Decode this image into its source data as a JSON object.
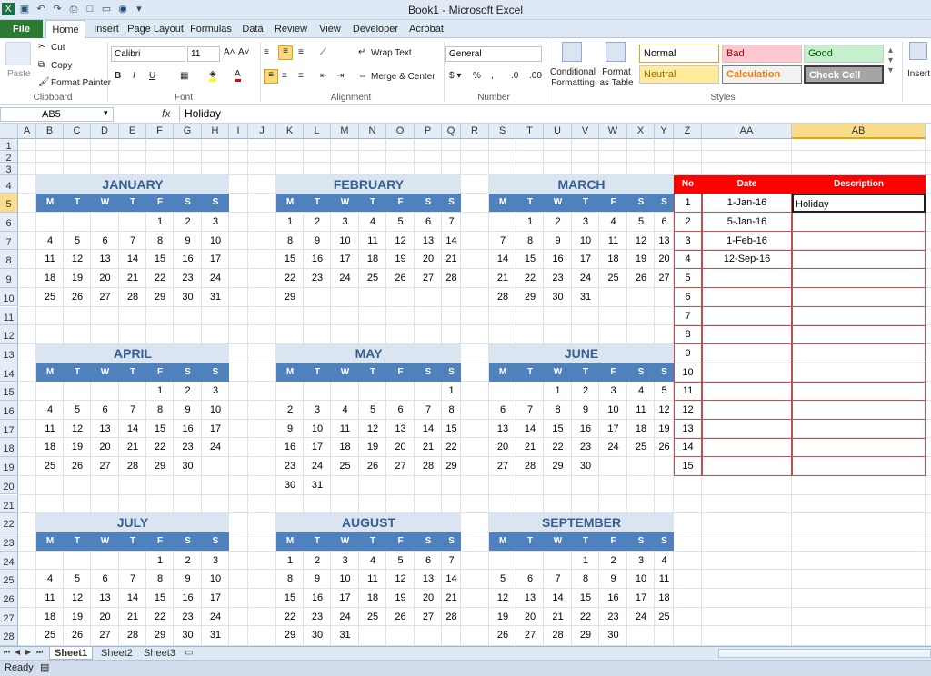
{
  "window": {
    "title": "Book1  -  Microsoft Excel"
  },
  "tabs": [
    "File",
    "Home",
    "Insert",
    "Page Layout",
    "Formulas",
    "Data",
    "Review",
    "View",
    "Developer",
    "Acrobat"
  ],
  "ribbon": {
    "clipboard": {
      "paste": "Paste",
      "cut": "Cut",
      "copy": "Copy",
      "format_painter": "Format Painter",
      "label": "Clipboard"
    },
    "font": {
      "name": "Calibri",
      "size": "11",
      "label": "Font"
    },
    "alignment": {
      "wrap": "Wrap Text",
      "merge": "Merge & Center",
      "label": "Alignment"
    },
    "number": {
      "format": "General",
      "label": "Number"
    },
    "styles": {
      "conditional": "Conditional Formatting",
      "format_table": "Format as Table",
      "normal": "Normal",
      "bad": "Bad",
      "good": "Good",
      "neutral": "Neutral",
      "calculation": "Calculation",
      "check_cell": "Check Cell",
      "label": "Styles"
    },
    "cells": {
      "insert": "Insert"
    }
  },
  "formula_bar": {
    "name_box": "AB5",
    "fx": "fx",
    "value": "Holiday"
  },
  "columns": [
    "A",
    "B",
    "C",
    "D",
    "E",
    "F",
    "G",
    "H",
    "I",
    "J",
    "K",
    "L",
    "M",
    "N",
    "O",
    "P",
    "Q",
    "R",
    "S",
    "T",
    "U",
    "V",
    "W",
    "X",
    "Y",
    "Z",
    "AA",
    "AB"
  ],
  "rows": [
    "1",
    "2",
    "3",
    "4",
    "5",
    "6",
    "7",
    "8",
    "9",
    "10",
    "11",
    "12",
    "13",
    "14",
    "15",
    "16",
    "17",
    "18",
    "19",
    "20",
    "21",
    "22",
    "23",
    "24",
    "25",
    "26",
    "27",
    "28"
  ],
  "weekdays": [
    "M",
    "T",
    "W",
    "T",
    "F",
    "S",
    "S"
  ],
  "months": [
    {
      "name": "JANUARY",
      "weeks": [
        [
          "",
          "",
          "",
          "",
          "1",
          "2",
          "3"
        ],
        [
          "4",
          "5",
          "6",
          "7",
          "8",
          "9",
          "10"
        ],
        [
          "11",
          "12",
          "13",
          "14",
          "15",
          "16",
          "17"
        ],
        [
          "18",
          "19",
          "20",
          "21",
          "22",
          "23",
          "24"
        ],
        [
          "25",
          "26",
          "27",
          "28",
          "29",
          "30",
          "31"
        ]
      ]
    },
    {
      "name": "FEBRUARY",
      "weeks": [
        [
          "1",
          "2",
          "3",
          "4",
          "5",
          "6",
          "7"
        ],
        [
          "8",
          "9",
          "10",
          "11",
          "12",
          "13",
          "14"
        ],
        [
          "15",
          "16",
          "17",
          "18",
          "19",
          "20",
          "21"
        ],
        [
          "22",
          "23",
          "24",
          "25",
          "26",
          "27",
          "28"
        ],
        [
          "29",
          "",
          "",
          "",
          "",
          "",
          ""
        ]
      ]
    },
    {
      "name": "MARCH",
      "weeks": [
        [
          "",
          "1",
          "2",
          "3",
          "4",
          "5",
          "6"
        ],
        [
          "7",
          "8",
          "9",
          "10",
          "11",
          "12",
          "13"
        ],
        [
          "14",
          "15",
          "16",
          "17",
          "18",
          "19",
          "20"
        ],
        [
          "21",
          "22",
          "23",
          "24",
          "25",
          "26",
          "27"
        ],
        [
          "28",
          "29",
          "30",
          "31",
          "",
          "",
          ""
        ]
      ]
    },
    {
      "name": "APRIL",
      "weeks": [
        [
          "",
          "",
          "",
          "",
          "1",
          "2",
          "3"
        ],
        [
          "4",
          "5",
          "6",
          "7",
          "8",
          "9",
          "10"
        ],
        [
          "11",
          "12",
          "13",
          "14",
          "15",
          "16",
          "17"
        ],
        [
          "18",
          "19",
          "20",
          "21",
          "22",
          "23",
          "24"
        ],
        [
          "25",
          "26",
          "27",
          "28",
          "29",
          "30",
          ""
        ]
      ]
    },
    {
      "name": "MAY",
      "weeks": [
        [
          "",
          "",
          "",
          "",
          "",
          "",
          "1"
        ],
        [
          "2",
          "3",
          "4",
          "5",
          "6",
          "7",
          "8"
        ],
        [
          "9",
          "10",
          "11",
          "12",
          "13",
          "14",
          "15"
        ],
        [
          "16",
          "17",
          "18",
          "19",
          "20",
          "21",
          "22"
        ],
        [
          "23",
          "24",
          "25",
          "26",
          "27",
          "28",
          "29"
        ],
        [
          "30",
          "31",
          "",
          "",
          "",
          "",
          ""
        ]
      ]
    },
    {
      "name": "JUNE",
      "weeks": [
        [
          "",
          "",
          "1",
          "2",
          "3",
          "4",
          "5"
        ],
        [
          "6",
          "7",
          "8",
          "9",
          "10",
          "11",
          "12"
        ],
        [
          "13",
          "14",
          "15",
          "16",
          "17",
          "18",
          "19"
        ],
        [
          "20",
          "21",
          "22",
          "23",
          "24",
          "25",
          "26"
        ],
        [
          "27",
          "28",
          "29",
          "30",
          "",
          "",
          ""
        ]
      ]
    },
    {
      "name": "JULY",
      "weeks": [
        [
          "",
          "",
          "",
          "",
          "1",
          "2",
          "3"
        ],
        [
          "4",
          "5",
          "6",
          "7",
          "8",
          "9",
          "10"
        ],
        [
          "11",
          "12",
          "13",
          "14",
          "15",
          "16",
          "17"
        ],
        [
          "18",
          "19",
          "20",
          "21",
          "22",
          "23",
          "24"
        ],
        [
          "25",
          "26",
          "27",
          "28",
          "29",
          "30",
          "31"
        ]
      ]
    },
    {
      "name": "AUGUST",
      "weeks": [
        [
          "1",
          "2",
          "3",
          "4",
          "5",
          "6",
          "7"
        ],
        [
          "8",
          "9",
          "10",
          "11",
          "12",
          "13",
          "14"
        ],
        [
          "15",
          "16",
          "17",
          "18",
          "19",
          "20",
          "21"
        ],
        [
          "22",
          "23",
          "24",
          "25",
          "26",
          "27",
          "28"
        ],
        [
          "29",
          "30",
          "31",
          "",
          "",
          "",
          ""
        ]
      ]
    },
    {
      "name": "SEPTEMBER",
      "weeks": [
        [
          "",
          "",
          "",
          "1",
          "2",
          "3",
          "4"
        ],
        [
          "5",
          "6",
          "7",
          "8",
          "9",
          "10",
          "11"
        ],
        [
          "12",
          "13",
          "14",
          "15",
          "16",
          "17",
          "18"
        ],
        [
          "19",
          "20",
          "21",
          "22",
          "23",
          "24",
          "25"
        ],
        [
          "26",
          "27",
          "28",
          "29",
          "30",
          "",
          ""
        ]
      ]
    }
  ],
  "holiday_table": {
    "headers": [
      "No",
      "Date",
      "Description"
    ],
    "rows": [
      [
        "1",
        "1-Jan-16",
        "Holiday"
      ],
      [
        "2",
        "5-Jan-16",
        ""
      ],
      [
        "3",
        "1-Feb-16",
        ""
      ],
      [
        "4",
        "12-Sep-16",
        ""
      ],
      [
        "5",
        "",
        ""
      ],
      [
        "6",
        "",
        ""
      ],
      [
        "7",
        "",
        ""
      ],
      [
        "8",
        "",
        ""
      ],
      [
        "9",
        "",
        ""
      ],
      [
        "10",
        "",
        ""
      ],
      [
        "11",
        "",
        ""
      ],
      [
        "12",
        "",
        ""
      ],
      [
        "13",
        "",
        ""
      ],
      [
        "14",
        "",
        ""
      ],
      [
        "15",
        "",
        ""
      ]
    ]
  },
  "sheets": [
    "Sheet1",
    "Sheet2",
    "Sheet3"
  ],
  "status": "Ready"
}
